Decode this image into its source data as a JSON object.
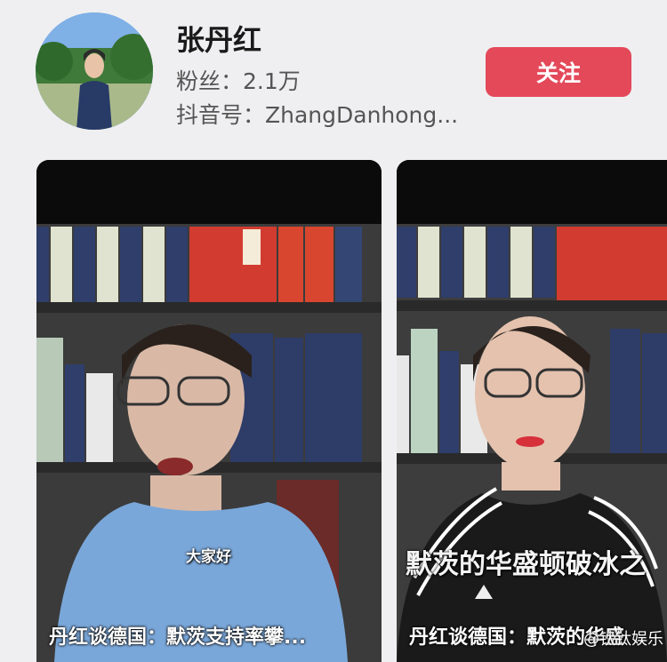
{
  "profile": {
    "name": "张丹红",
    "fans": "粉丝：2.1万",
    "douyin_id": "抖音号：ZhangDanhong...",
    "follow_label": "关注"
  },
  "videos": [
    {
      "subtitle": "大家好",
      "caption": "丹红谈德国：默茨支持率攀..."
    },
    {
      "subtitle": "默茨的华盛顿破冰之",
      "caption": "丹红谈德国：默茨的华盛",
      "watermark": "@钛钛娱乐"
    }
  ],
  "colors": {
    "follow_button": "#e4495a",
    "page_background": "#efeff1"
  }
}
